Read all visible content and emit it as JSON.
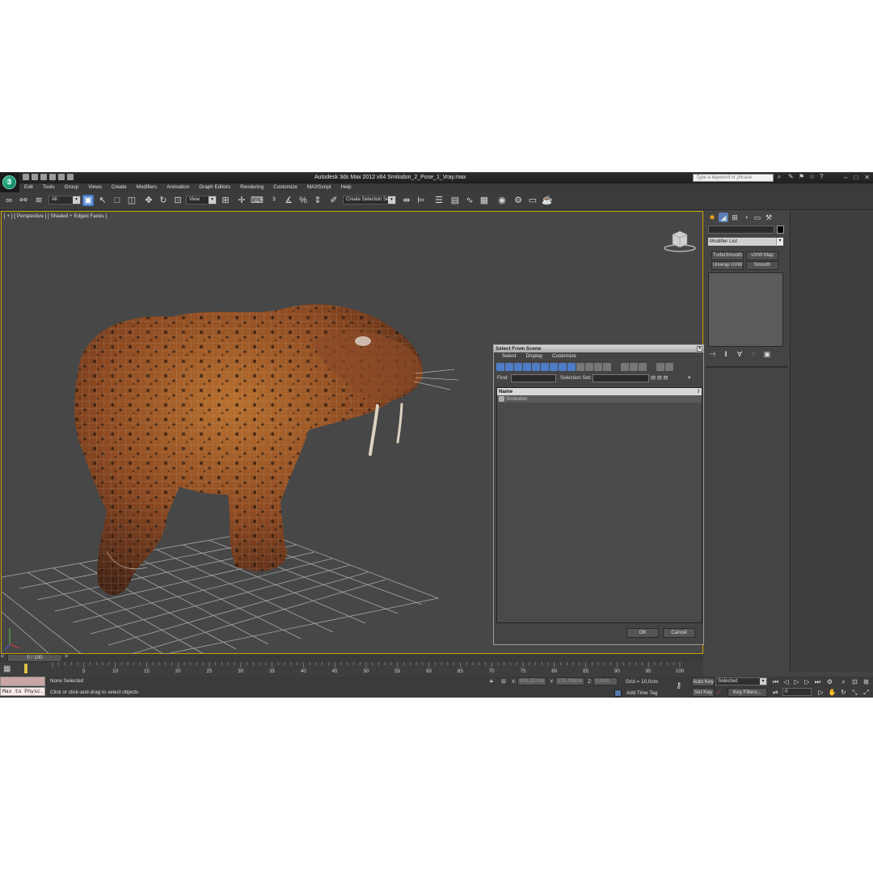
{
  "window": {
    "title": "Autodesk 3ds Max  2012 x64     Smilodon_2_Pose_1_Vray.max",
    "search_placeholder": "Type a keyword or phrase",
    "logo_letter": "3"
  },
  "menu": [
    "Edit",
    "Tools",
    "Group",
    "Views",
    "Create",
    "Modifiers",
    "Animation",
    "Graph Editors",
    "Rendering",
    "Customize",
    "MAXScript",
    "Help"
  ],
  "toolbar": {
    "filter_value": "All",
    "ref_coord_value": "View",
    "selection_set_value": "Create Selection Se"
  },
  "viewport": {
    "label": "[ + ] [ Perspective ] [ Shaded + Edged Faces ]"
  },
  "dialog": {
    "title": "Select From Scene",
    "close": "x",
    "menu": [
      "Select",
      "Display",
      "Customize"
    ],
    "find_label": "Find:",
    "selection_set_label": "Selection Set:",
    "column_name": "Name",
    "column_sort": "/",
    "items": [
      "Smilodon"
    ],
    "ok": "OK",
    "cancel": "Cancel"
  },
  "command_panel": {
    "modifier_list": "Modifier List",
    "buttons": [
      "TurboSmooth",
      "UVW Map",
      "Unwrap UVW",
      "Smooth"
    ]
  },
  "timeline": {
    "slider": "0 / 100",
    "left_arrow": "<",
    "right_arrow": ">",
    "ticks": [
      "5",
      "10",
      "15",
      "20",
      "25",
      "30",
      "35",
      "40",
      "45",
      "50",
      "55",
      "60",
      "65",
      "70",
      "75",
      "80",
      "85",
      "90",
      "95",
      "100"
    ]
  },
  "status": {
    "maxscript": "Max to Physc.",
    "selection": "None Selected",
    "prompt": "Click or click-and-drag to select objects",
    "x_label": "X:",
    "x_value": "610,237cm",
    "y_label": "Y:",
    "y_value": "275,798cm",
    "z_label": "Z:",
    "z_value": "0,0cm",
    "grid": "Grid = 10,0cm",
    "add_time_tag": "Add Time Tag",
    "auto_key": "Auto Key",
    "set_key": "Set Key",
    "selected": "Selected",
    "key_filters": "Key Filters...",
    "frame": "0"
  }
}
